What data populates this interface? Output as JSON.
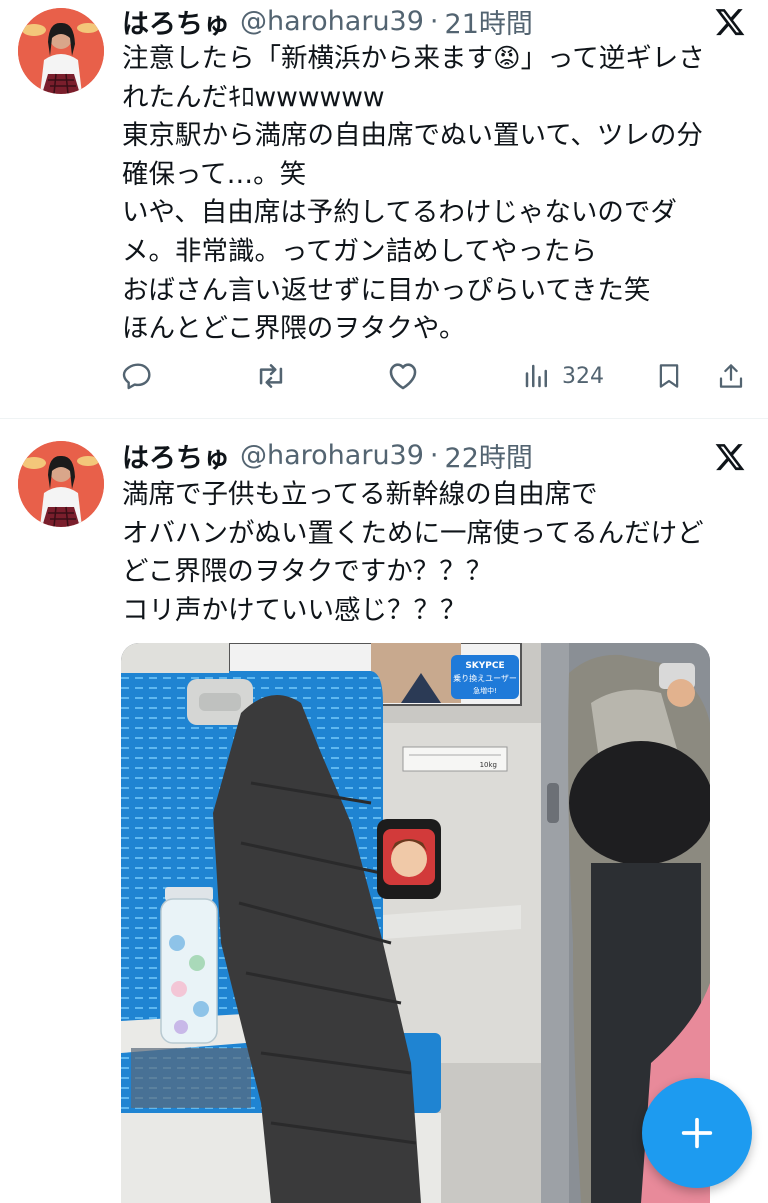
{
  "colors": {
    "accent": "#1d9bf0",
    "text": "#0f1419",
    "secondary": "#536471"
  },
  "tweets": [
    {
      "display_name": "はろちゅ",
      "handle": "@haroharu39",
      "separator": "·",
      "time": "21時間",
      "lines": [
        "注意したら「新横浜から来ます😡」って逆ギレさ",
        "れたんだｷﾛwwwwww",
        "東京駅から満席の自由席でぬい置いて、ツレの分",
        "確保って…。笑",
        "いや、自由席は予約してるわけじゃないのでダ",
        "メ。非常識。ってガン詰めしてやったら",
        "おばさん言い返せずに目かっぴらいてきた笑",
        "ほんとどこ界隈のヲタクや。"
      ],
      "views": "324"
    },
    {
      "display_name": "はろちゅ",
      "handle": "@haroharu39",
      "separator": "·",
      "time": "22時間",
      "lines": [
        "満席で子供も立ってる新幹線の自由席で",
        "オバハンがぬい置くために一席使ってるんだけど",
        "どこ界隈のヲタクですか？？？",
        "コリ声かけていい感じ？？？"
      ],
      "photo": {
        "ad_brand": "SKYPCE",
        "ad_line1": "乗り換えユーザー",
        "ad_line2": "急増中!",
        "table_weight": "10kg"
      }
    }
  ],
  "icons": [
    "avatar",
    "x-logo-icon",
    "reply-icon",
    "retweet-icon",
    "like-icon",
    "views-icon",
    "bookmark-icon",
    "share-icon",
    "plus-icon"
  ]
}
